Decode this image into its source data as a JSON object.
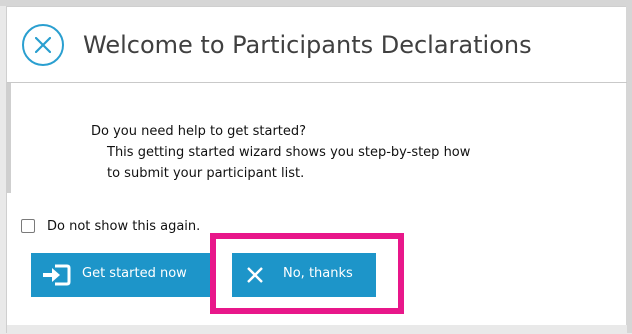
{
  "dialog": {
    "title": "Welcome to Participants Declarations",
    "close_icon": "circle-x-icon"
  },
  "body": {
    "question": "Do you need help to get started?",
    "desc_line1": "This getting started wizard shows you step-by-step how",
    "desc_line2": "to submit your participant list."
  },
  "options": {
    "dont_show_label": "Do not show this again.",
    "dont_show_checked": false
  },
  "buttons": {
    "start_label": "Get started now",
    "start_icon": "sign-in-icon",
    "no_label": "No, thanks",
    "no_icon": "x-icon"
  },
  "colors": {
    "accent": "#1d95c9",
    "highlight": "#e8178a"
  }
}
